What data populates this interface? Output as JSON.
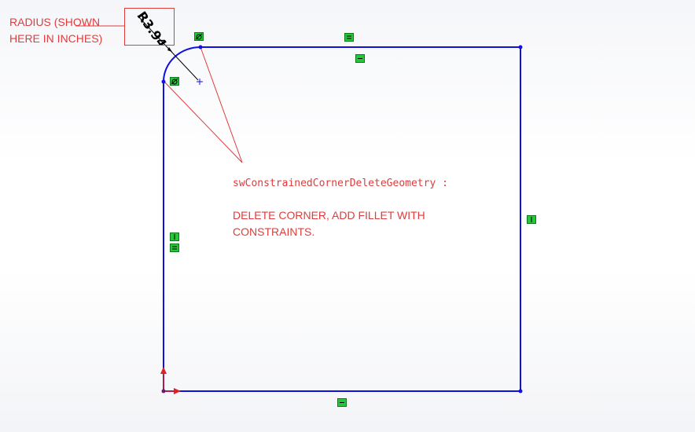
{
  "annotations": {
    "radius_note": "RADIUS (SHOWN HERE IN INCHES)",
    "title": "swConstrainedCornerDeleteGeometry :",
    "description": "DELETE CORNER, ADD FILLET WITH CONSTRAINTS."
  },
  "dimension": {
    "label": "R3.94"
  },
  "relations": {
    "tangent_top": "tangent-icon",
    "tangent_left": "tangent-icon",
    "equal_top": {
      "icon": "equal-icon",
      "index": "0"
    },
    "horizontal_top": "horizontal-icon",
    "vertical_right": "vertical-icon",
    "vertical_left": "vertical-icon",
    "equal_left": {
      "icon": "equal-icon",
      "index": "0"
    },
    "horizontal_bottom": "horizontal-icon"
  },
  "colors": {
    "sketch_line": "#1010e0",
    "annotation": "#e03c3c",
    "relation_fill": "#27c63a",
    "origin_arrow": "#e02020"
  }
}
